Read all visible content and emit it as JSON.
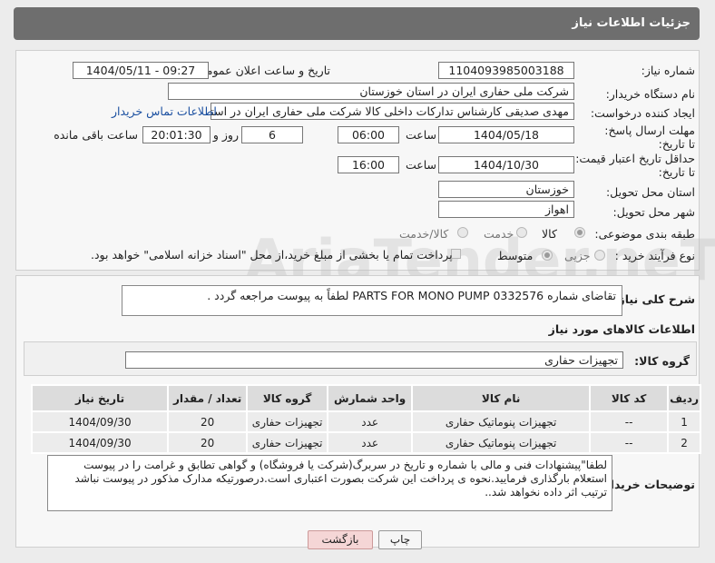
{
  "header": {
    "title": "جزئیات اطلاعات نیاز"
  },
  "form": {
    "need_number_label": "شماره نیاز:",
    "need_number": "1104093985003188",
    "announce_label": "تاریخ و ساعت اعلان عمومی:",
    "announce_value": "1404/05/11 - 09:27",
    "buyer_org_label": "نام دستگاه خریدار:",
    "buyer_org": "شرکت ملی حفاری ایران در استان خوزستان",
    "creator_label": "ایجاد کننده درخواست:",
    "creator": "مهدی صدیقی کارشناس تدارکات داخلی کالا شرکت ملی حفاری ایران در استان",
    "contact_link": "اطلاعات تماس خریدار",
    "deadline_label": "مهلت ارسال پاسخ: تا تاریخ:",
    "deadline_date": "1404/05/18",
    "time_label": "ساعت",
    "deadline_time": "06:00",
    "days_value": "6",
    "days_word": "روز و",
    "remaining_time": "20:01:30",
    "remaining_label": "ساعت باقی مانده",
    "validity_label": "حداقل تاریخ اعتبار قیمت: تا تاریخ:",
    "validity_date": "1404/10/30",
    "validity_time": "16:00",
    "province_label": "استان محل تحویل:",
    "province": "خوزستان",
    "city_label": "شهر محل تحویل:",
    "city": "اهواز",
    "category_label": "طبقه بندی موضوعی:",
    "category_options": [
      "کالا",
      "خدمت",
      "کالا/خدمت"
    ],
    "category_selected": "کالا",
    "process_label": "نوع فرآیند خرید :",
    "process_options": [
      "جزیی",
      "متوسط"
    ],
    "process_selected": "متوسط",
    "payment_note": "پرداخت تمام یا بخشی از مبلغ خرید،از محل \"اسناد خزانه اسلامی\" خواهد بود."
  },
  "description": {
    "label": "شرح کلی نیاز:",
    "text": "تقاضای شماره PARTS FOR MONO PUMP 0332576 لطفاً به پیوست مراجعه گردد ."
  },
  "goods": {
    "section_title": "اطلاعات کالاهای مورد نیاز",
    "group_label": "گروه کالا:",
    "group_value": "تجهیزات حفاری",
    "columns": [
      "ردیف",
      "کد کالا",
      "نام کالا",
      "واحد شمارش",
      "گروه کالا",
      "تعداد / مقدار",
      "تاریخ نیاز"
    ],
    "rows": [
      [
        "1",
        "--",
        "تجهیزات پنوماتیک حفاری",
        "عدد",
        "تجهیزات حفاری",
        "20",
        "1404/09/30"
      ],
      [
        "2",
        "--",
        "تجهیزات پنوماتیک حفاری",
        "عدد",
        "تجهیزات حفاری",
        "20",
        "1404/09/30"
      ]
    ]
  },
  "buyer_notes": {
    "label": "توضیحات خریدار:",
    "text": "لطفا\"پیشنهادات فنی و مالی با شماره و تاریخ در سربرگ(شرکت یا فروشگاه) و گواهی تطابق و غرامت را در پیوست استعلام بارگذاری فرمایید.نحوه ی پرداخت این شرکت بصورت اعتباری است.درصورتیکه مدارک مذکور در پیوست نباشد ترتیب اثر داده نخواهد شد.."
  },
  "buttons": {
    "print": "چاپ",
    "back": "بازگشت"
  },
  "watermark": "AriaTender.neT",
  "colors": {
    "header_bg": "#6e6e6e",
    "link": "#1a4fa0",
    "back_button_bg": "#f5d6d6"
  }
}
